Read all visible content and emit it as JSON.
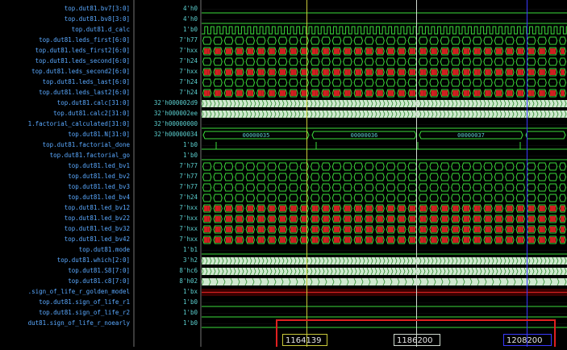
{
  "signals": [
    {
      "name": "top.dut81.bv7[3:0]",
      "value": "4'h0",
      "kind": "flat"
    },
    {
      "name": "top.dut81.bv8[3:0]",
      "value": "4'h0",
      "kind": "flat"
    },
    {
      "name": "top.dut81.d_calc",
      "value": "1'b0",
      "kind": "clock"
    },
    {
      "name": "top.dut81.leds_first[6:0]",
      "value": "7'h77",
      "kind": "bus"
    },
    {
      "name": "top.dut81.leds_first2[6:0]",
      "value": "7'hxx",
      "kind": "xbus"
    },
    {
      "name": "top.dut81.leds_second[6:0]",
      "value": "7'h24",
      "kind": "bus"
    },
    {
      "name": "top.dut81.leds_second2[6:0]",
      "value": "7'hxx",
      "kind": "xbus"
    },
    {
      "name": "top.dut81.leds_last[6:0]",
      "value": "7'h24",
      "kind": "bus"
    },
    {
      "name": "top.dut81.leds_last2[6:0]",
      "value": "7'h24",
      "kind": "xbus"
    },
    {
      "name": "top.dut81.calc[31:0]",
      "value": "32'h000002d9",
      "kind": "dense"
    },
    {
      "name": "top.dut81.calc2[31:0]",
      "value": "32'h000002ee",
      "kind": "dense"
    },
    {
      "name": "1.factorial_calculated[31:0]",
      "value": "32'h00000000",
      "kind": "flat"
    },
    {
      "name": "top.dut81.N[31:0]",
      "value": "32'h00000034",
      "kind": "labeled"
    },
    {
      "name": "top.dut81.factorial_done",
      "value": "1'b0",
      "kind": "pulse"
    },
    {
      "name": "top.dut81.factorial_go",
      "value": "1'b0",
      "kind": "flat"
    },
    {
      "name": "top.dut81.led_bv1",
      "value": "7'h77",
      "kind": "bus"
    },
    {
      "name": "top.dut81.led_bv2",
      "value": "7'h77",
      "kind": "bus"
    },
    {
      "name": "top.dut81.led_bv3",
      "value": "7'h77",
      "kind": "bus"
    },
    {
      "name": "top.dut81.led_bv4",
      "value": "7'h24",
      "kind": "bus"
    },
    {
      "name": "top.dut81.led_bv12",
      "value": "7'hxx",
      "kind": "xbus"
    },
    {
      "name": "top.dut81.led_bv22",
      "value": "7'hxx",
      "kind": "xbus"
    },
    {
      "name": "top.dut81.led_bv32",
      "value": "7'hxx",
      "kind": "xbus"
    },
    {
      "name": "top.dut81.led_bv42",
      "value": "7'hxx",
      "kind": "xbus"
    },
    {
      "name": "top.dut81.mode",
      "value": "1'b1",
      "kind": "flat"
    },
    {
      "name": "top.dut81.which[2:0]",
      "value": "3'h2",
      "kind": "dense"
    },
    {
      "name": "top.dut81.S8[7:0]",
      "value": "8'hc6",
      "kind": "dense"
    },
    {
      "name": "top.dut81.c8[7:0]",
      "value": "8'h02",
      "kind": "dense2"
    },
    {
      "name": ".sign_of_life_r_golden_model",
      "value": "1'bx",
      "kind": "red"
    },
    {
      "name": "top.dut81.sign_of_life_r1",
      "value": "1'b0",
      "kind": "flat"
    },
    {
      "name": "top.dut81.sign_of_life_r2",
      "value": "1'b0",
      "kind": "flat"
    },
    {
      "name": "dut81.sign_of_life_r_noearly",
      "value": "1'b0",
      "kind": "flat"
    }
  ],
  "n_labels": [
    "00000035",
    "00000036",
    "00000037"
  ],
  "cursors": [
    {
      "time": "1164139",
      "color": "#c9c93a"
    },
    {
      "time": "1186200",
      "color": "#cfd9cf"
    },
    {
      "time": "1208200",
      "color": "#3a3aff"
    }
  ],
  "colors": {
    "wave": "#3bdc3b",
    "x": "#d02020",
    "busfill": "#cfe8cf",
    "name": "#5aa9ff",
    "value": "#5cd0d0"
  }
}
